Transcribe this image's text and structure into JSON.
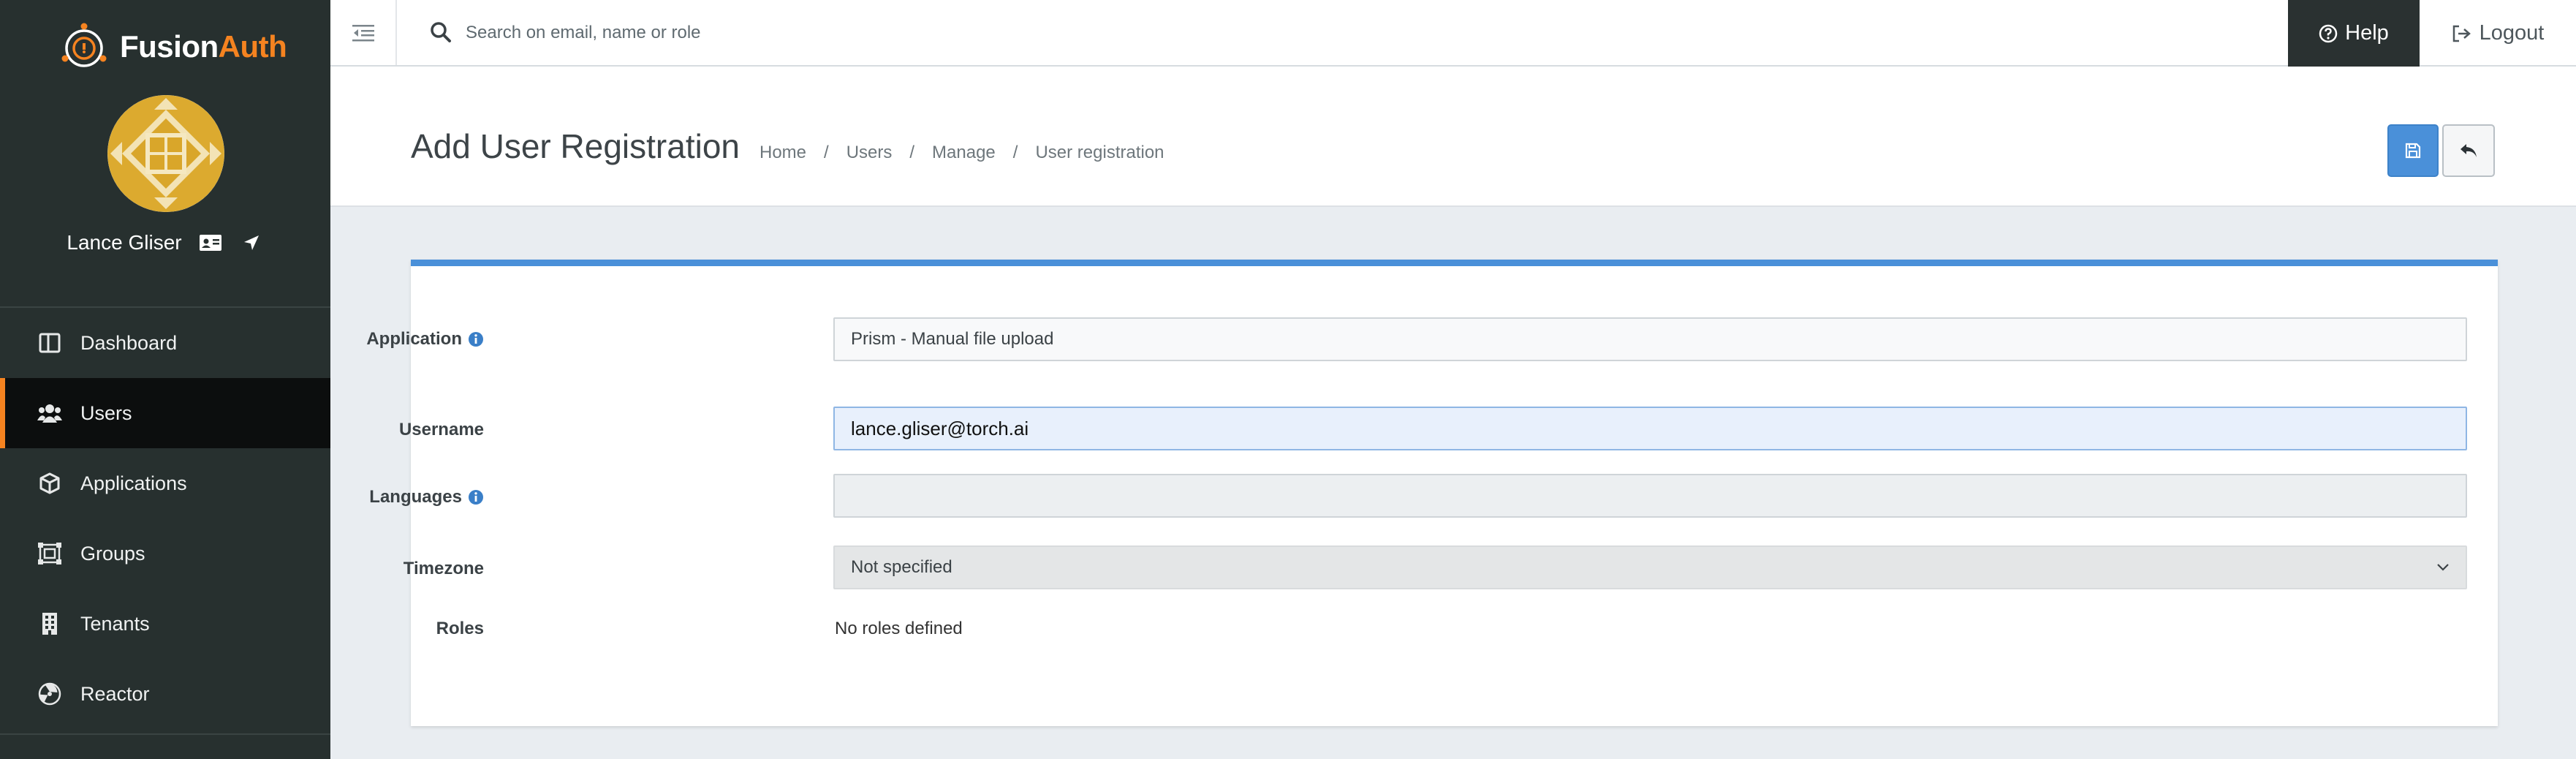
{
  "brand": {
    "name_part1": "Fusion",
    "name_part2": "Auth",
    "accent_color": "#f58320"
  },
  "user": {
    "name": "Lance Gliser"
  },
  "sidebar": {
    "items": [
      {
        "label": "Dashboard",
        "icon": "dashboard-icon"
      },
      {
        "label": "Users",
        "icon": "users-icon",
        "active": true
      },
      {
        "label": "Applications",
        "icon": "cube-icon"
      },
      {
        "label": "Groups",
        "icon": "groups-icon"
      },
      {
        "label": "Tenants",
        "icon": "building-icon"
      },
      {
        "label": "Reactor",
        "icon": "radiation-icon"
      }
    ]
  },
  "topbar": {
    "search_placeholder": "Search on email, name or role",
    "help_label": "Help",
    "logout_label": "Logout"
  },
  "header": {
    "title": "Add User Registration",
    "breadcrumb": [
      "Home",
      "Users",
      "Manage",
      "User registration"
    ],
    "separator": "/"
  },
  "form": {
    "application": {
      "label": "Application",
      "value": "Prism - Manual file upload"
    },
    "username": {
      "label": "Username",
      "value": "lance.gliser@torch.ai"
    },
    "languages": {
      "label": "Languages",
      "value": ""
    },
    "timezone": {
      "label": "Timezone",
      "value": "Not specified"
    },
    "roles": {
      "label": "Roles",
      "value": "No roles defined"
    }
  },
  "colors": {
    "sidebar_bg": "#27302f",
    "primary": "#4a90d9",
    "page_bg": "#e9edf1"
  }
}
